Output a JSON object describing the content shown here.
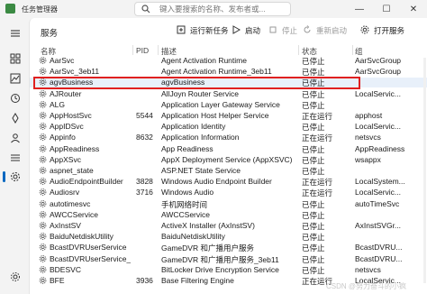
{
  "window": {
    "title": "任务管理器",
    "search_placeholder": "键入要搜索的名称、发布者或...",
    "controls": {
      "minimize": "—",
      "maximize": "☐",
      "close": "✕"
    }
  },
  "nav": {
    "icons": [
      "hamburger-icon",
      "performance-chart-icon",
      "app-history-icon",
      "processes-icon",
      "startup-icon",
      "users-icon",
      "details-list-icon",
      "services-icon"
    ],
    "bottom_icon": "settings-icon"
  },
  "toolbar": {
    "title": "服务",
    "run_new_task": "运行新任务",
    "start": "启动",
    "stop": "停止",
    "restart": "重新启动",
    "open_services": "打开服务"
  },
  "table": {
    "headers": {
      "name": "名称",
      "pid": "PID",
      "description": "描述",
      "status": "状态",
      "group": "组"
    },
    "rows": [
      {
        "name": "AarSvc",
        "pid": "",
        "desc": "Agent Activation Runtime",
        "status": "已停止",
        "group": "AarSvcGroup"
      },
      {
        "name": "AarSvc_3eb11",
        "pid": "",
        "desc": "Agent Activation Runtime_3eb11",
        "status": "已停止",
        "group": "AarSvcGroup"
      },
      {
        "name": "agvBusiness",
        "pid": "",
        "desc": "agvBusiness",
        "status": "已停止",
        "group": ""
      },
      {
        "name": "AJRouter",
        "pid": "",
        "desc": "AllJoyn Router Service",
        "status": "已停止",
        "group": "LocalServic..."
      },
      {
        "name": "ALG",
        "pid": "",
        "desc": "Application Layer Gateway Service",
        "status": "已停止",
        "group": ""
      },
      {
        "name": "AppHostSvc",
        "pid": "5544",
        "desc": "Application Host Helper Service",
        "status": "正在运行",
        "group": "apphost"
      },
      {
        "name": "AppIDSvc",
        "pid": "",
        "desc": "Application Identity",
        "status": "已停止",
        "group": "LocalServic..."
      },
      {
        "name": "Appinfo",
        "pid": "8632",
        "desc": "Application Information",
        "status": "正在运行",
        "group": "netsvcs"
      },
      {
        "name": "AppReadiness",
        "pid": "",
        "desc": "App Readiness",
        "status": "已停止",
        "group": "AppReadiness"
      },
      {
        "name": "AppXSvc",
        "pid": "",
        "desc": "AppX Deployment Service (AppXSVC)",
        "status": "已停止",
        "group": "wsappx"
      },
      {
        "name": "aspnet_state",
        "pid": "",
        "desc": "ASP.NET State Service",
        "status": "已停止",
        "group": ""
      },
      {
        "name": "AudioEndpointBuilder",
        "pid": "3828",
        "desc": "Windows Audio Endpoint Builder",
        "status": "正在运行",
        "group": "LocalSystem..."
      },
      {
        "name": "Audiosrv",
        "pid": "3716",
        "desc": "Windows Audio",
        "status": "正在运行",
        "group": "LocalServic..."
      },
      {
        "name": "autotimesvc",
        "pid": "",
        "desc": "手机网络时间",
        "status": "已停止",
        "group": "autoTimeSvc"
      },
      {
        "name": "AWCCService",
        "pid": "",
        "desc": "AWCCService",
        "status": "已停止",
        "group": ""
      },
      {
        "name": "AxInstSV",
        "pid": "",
        "desc": "ActiveX Installer (AxInstSV)",
        "status": "已停止",
        "group": "AxInstSVGr..."
      },
      {
        "name": "BaiduNetdiskUtility",
        "pid": "",
        "desc": "BaiduNetdiskUtility",
        "status": "已停止",
        "group": ""
      },
      {
        "name": "BcastDVRUserService",
        "pid": "",
        "desc": "GameDVR 和广播用户服务",
        "status": "已停止",
        "group": "BcastDVRU..."
      },
      {
        "name": "BcastDVRUserService_...",
        "pid": "",
        "desc": "GameDVR 和广播用户服务_3eb11",
        "status": "已停止",
        "group": "BcastDVRU..."
      },
      {
        "name": "BDESVC",
        "pid": "",
        "desc": "BitLocker Drive Encryption Service",
        "status": "已停止",
        "group": "netsvcs"
      },
      {
        "name": "BFE",
        "pid": "3936",
        "desc": "Base Filtering Engine",
        "status": "正在运行",
        "group": "LocalServic..."
      }
    ]
  },
  "watermark": "CSDN @努力奋斗的小疯"
}
